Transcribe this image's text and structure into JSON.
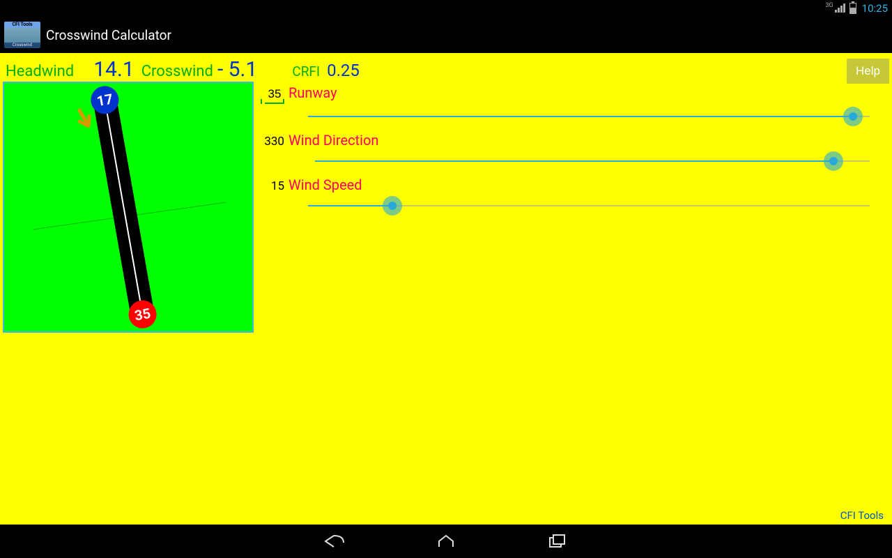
{
  "status_bar": {
    "network_label": "3G",
    "time": "10:25"
  },
  "action_bar": {
    "logo_top": "CFI Tools",
    "logo_bottom": "Crosswind",
    "title": "Crosswind Calculator"
  },
  "results": {
    "headwind_label": "Headwind",
    "headwind_value": "14.1",
    "crosswind_label": "Crosswind",
    "crosswind_value": "- 5.1",
    "crfi_label": "CRFI",
    "crfi_value": "0.25",
    "help_label": "Help"
  },
  "runway_viz": {
    "near_marker": "17",
    "far_marker": "35"
  },
  "sliders": {
    "runway": {
      "label": "Runway",
      "value": "35",
      "percent": 97
    },
    "wind_direction": {
      "label": "Wind Direction",
      "value": "330",
      "percent": 93.5
    },
    "wind_speed": {
      "label": "Wind Speed",
      "value": "15",
      "percent": 15
    }
  },
  "footer": {
    "brand": "CFI Tools"
  }
}
